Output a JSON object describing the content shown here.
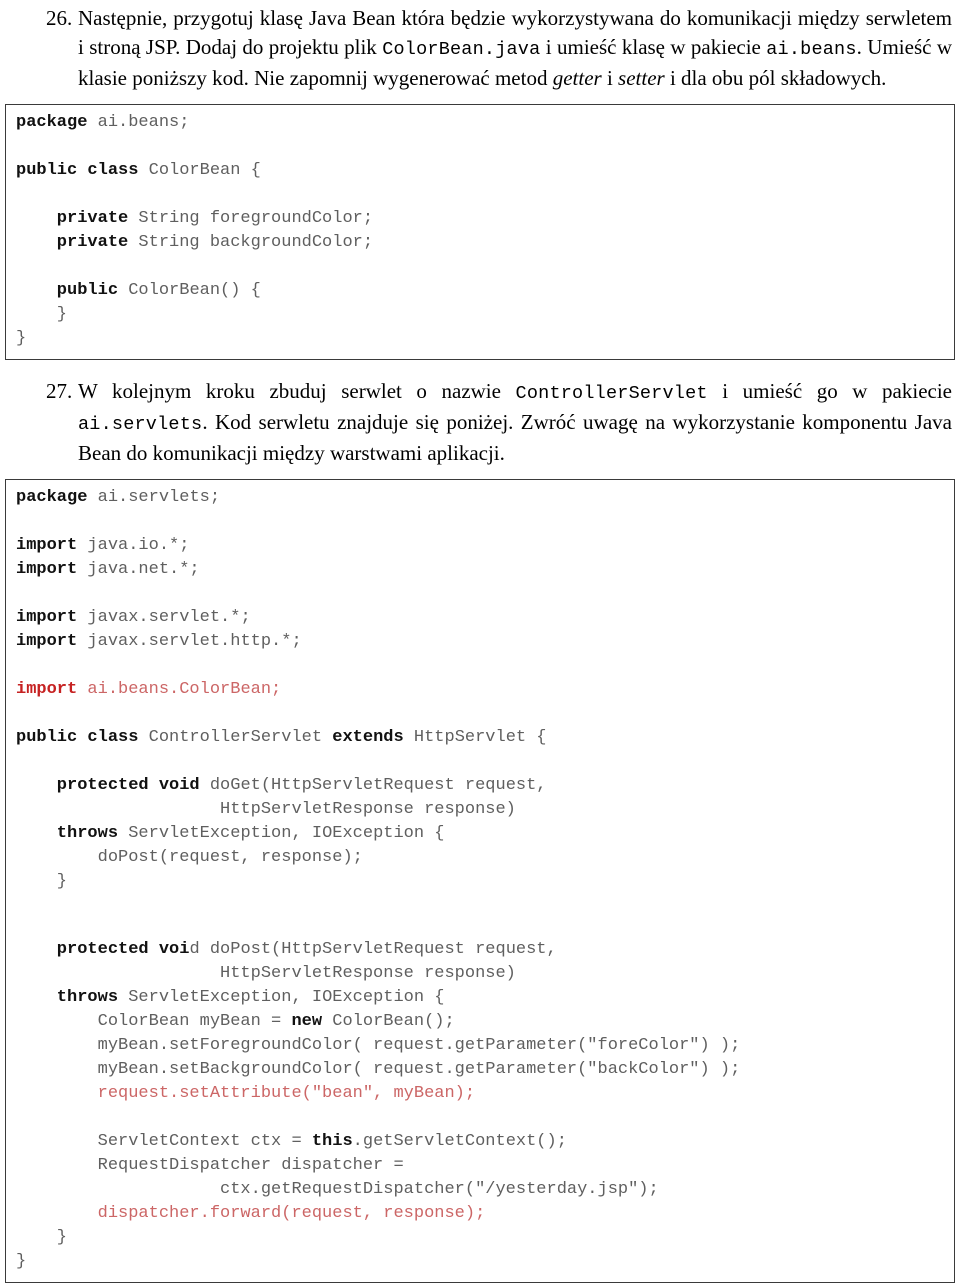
{
  "colors": {
    "text": "#000000",
    "code_plain": "#5f5f5f",
    "code_keyword": "#111111",
    "code_red_bold": "#c62222",
    "code_red_plain": "#cc6666",
    "code_border": "#3a3a3a",
    "page_background": "#ffffff"
  },
  "item26": {
    "marker": "26.",
    "text_part1": "Następnie, przygotuj klasę Java Bean która będzie wykorzystywana do komunikacji między serwletem i stroną JSP. Dodaj do projektu plik ",
    "mono1": "ColorBean.java",
    "text_part2": " i umieść klasę w pakiecie ",
    "mono2": "ai.beans",
    "text_part3": ". Umieść w klasie poniższy kod. Nie zapomnij wygenerować metod ",
    "ital1": "getter",
    "text_part4": " i ",
    "ital2": "setter",
    "text_part5": " i dla obu pól składowych."
  },
  "code_block_1": {
    "line1_kw": "package",
    "line1_rest": " ai.beans;",
    "line2_kw": "public class",
    "line2_rest": " ColorBean {",
    "line3_kw": "    private",
    "line3_rest": " String foregroundColor;",
    "line4_kw": "    private",
    "line4_rest": " String backgroundColor;",
    "line5_kw": "    public",
    "line5_rest": " ColorBean() {",
    "line6": "    }",
    "line7": "}"
  },
  "item27": {
    "marker": "27.",
    "text_part1": "W kolejnym kroku zbuduj serwlet o nazwie ",
    "mono1": "ControllerServlet",
    "text_part2": " i umieść go w pakiecie ",
    "mono2": "ai.servlets",
    "text_part3": ". Kod serwletu znajduje się poniżej. Zwróć uwagę na wykorzystanie komponentu Java Bean do komunikacji między warstwami aplikacji."
  },
  "code_block_2": {
    "package_kw": "package",
    "package_rest": " ai.servlets;",
    "import1_kw": "import",
    "import1_rest": " java.io.*;",
    "import2_kw": "import",
    "import2_rest": " java.net.*;",
    "import3_kw": "import",
    "import3_rest": " javax.servlet.*;",
    "import4_kw": "import",
    "import4_rest": " javax.servlet.http.*;",
    "import5_kw": "import",
    "import5_rest": " ai.beans.ColorBean;",
    "class_kw1": "public class",
    "class_name": " ControllerServlet ",
    "class_kw2": "extends",
    "class_super": " HttpServlet {",
    "doget_kw": "    protected void",
    "doget_rest": " doGet(HttpServletRequest request,",
    "doget_cont": "                    HttpServletResponse response)",
    "doget_throws_kw": "    throws",
    "doget_throws_rest": " ServletException, IOException {",
    "doget_body": "        doPost(request, response);",
    "doget_close": "    }",
    "dopost_kw": "    protected voi",
    "dopost_rest": "d doPost(HttpServletRequest request,",
    "dopost_cont": "                    HttpServletResponse response)",
    "dopost_throws_kw": "    throws",
    "dopost_throws_rest": " ServletException, IOException {",
    "dopost_l1_a": "        ColorBean myBean = ",
    "dopost_l1_kw": "new",
    "dopost_l1_b": " ColorBean();",
    "dopost_l2": "        myBean.setForegroundColor( request.getParameter(\"foreColor\") );",
    "dopost_l3": "        myBean.setBackgroundColor( request.getParameter(\"backColor\") );",
    "dopost_l4_red": "        request.setAttribute(\"bean\", myBean);",
    "dopost_l5_a": "        ServletContext ctx = ",
    "dopost_l5_kw": "this",
    "dopost_l5_b": ".getServletContext();",
    "dopost_l6": "        RequestDispatcher dispatcher =",
    "dopost_l7": "                    ctx.getRequestDispatcher(\"/yesterday.jsp\");",
    "dopost_l8_red": "        dispatcher.forward(request, response);",
    "dopost_close": "    }",
    "class_close": "}"
  }
}
